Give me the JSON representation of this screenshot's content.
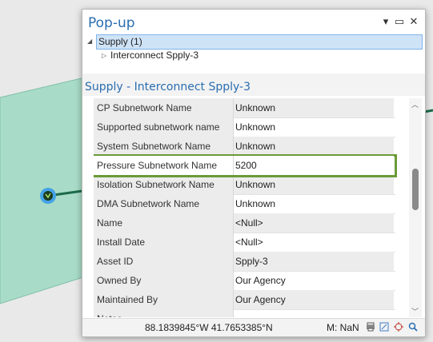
{
  "popup": {
    "title": "Pop-up",
    "tree": {
      "layer": "Supply (1)",
      "feature": "Interconnect Spply-3"
    },
    "feature_title": "Supply - Interconnect Spply-3",
    "attributes": [
      {
        "name": "CP Subnetwork Name",
        "value": "Unknown"
      },
      {
        "name": "Supported subnetwork name",
        "value": "Unknown"
      },
      {
        "name": "System Subnetwork Name",
        "value": "Unknown"
      },
      {
        "name": "Pressure Subnetwork Name",
        "value": "5200"
      },
      {
        "name": "Isolation Subnetwork Name",
        "value": "Unknown"
      },
      {
        "name": "DMA Subnetwork Name",
        "value": "Unknown"
      },
      {
        "name": "Name",
        "value": "<Null>"
      },
      {
        "name": "Install Date",
        "value": "<Null>"
      },
      {
        "name": "Asset ID",
        "value": "Spply-3"
      },
      {
        "name": "Owned By",
        "value": "Our Agency"
      },
      {
        "name": "Maintained By",
        "value": "Our Agency"
      },
      {
        "name": "Notes",
        "value": ""
      }
    ],
    "status": {
      "coordinates": "88.1839845°W 41.7653385°N",
      "m_value": "M: NaN"
    }
  },
  "colors": {
    "map_fill": "#a8dcc8",
    "highlight": "#6a9a36",
    "title": "#2a6db0"
  }
}
